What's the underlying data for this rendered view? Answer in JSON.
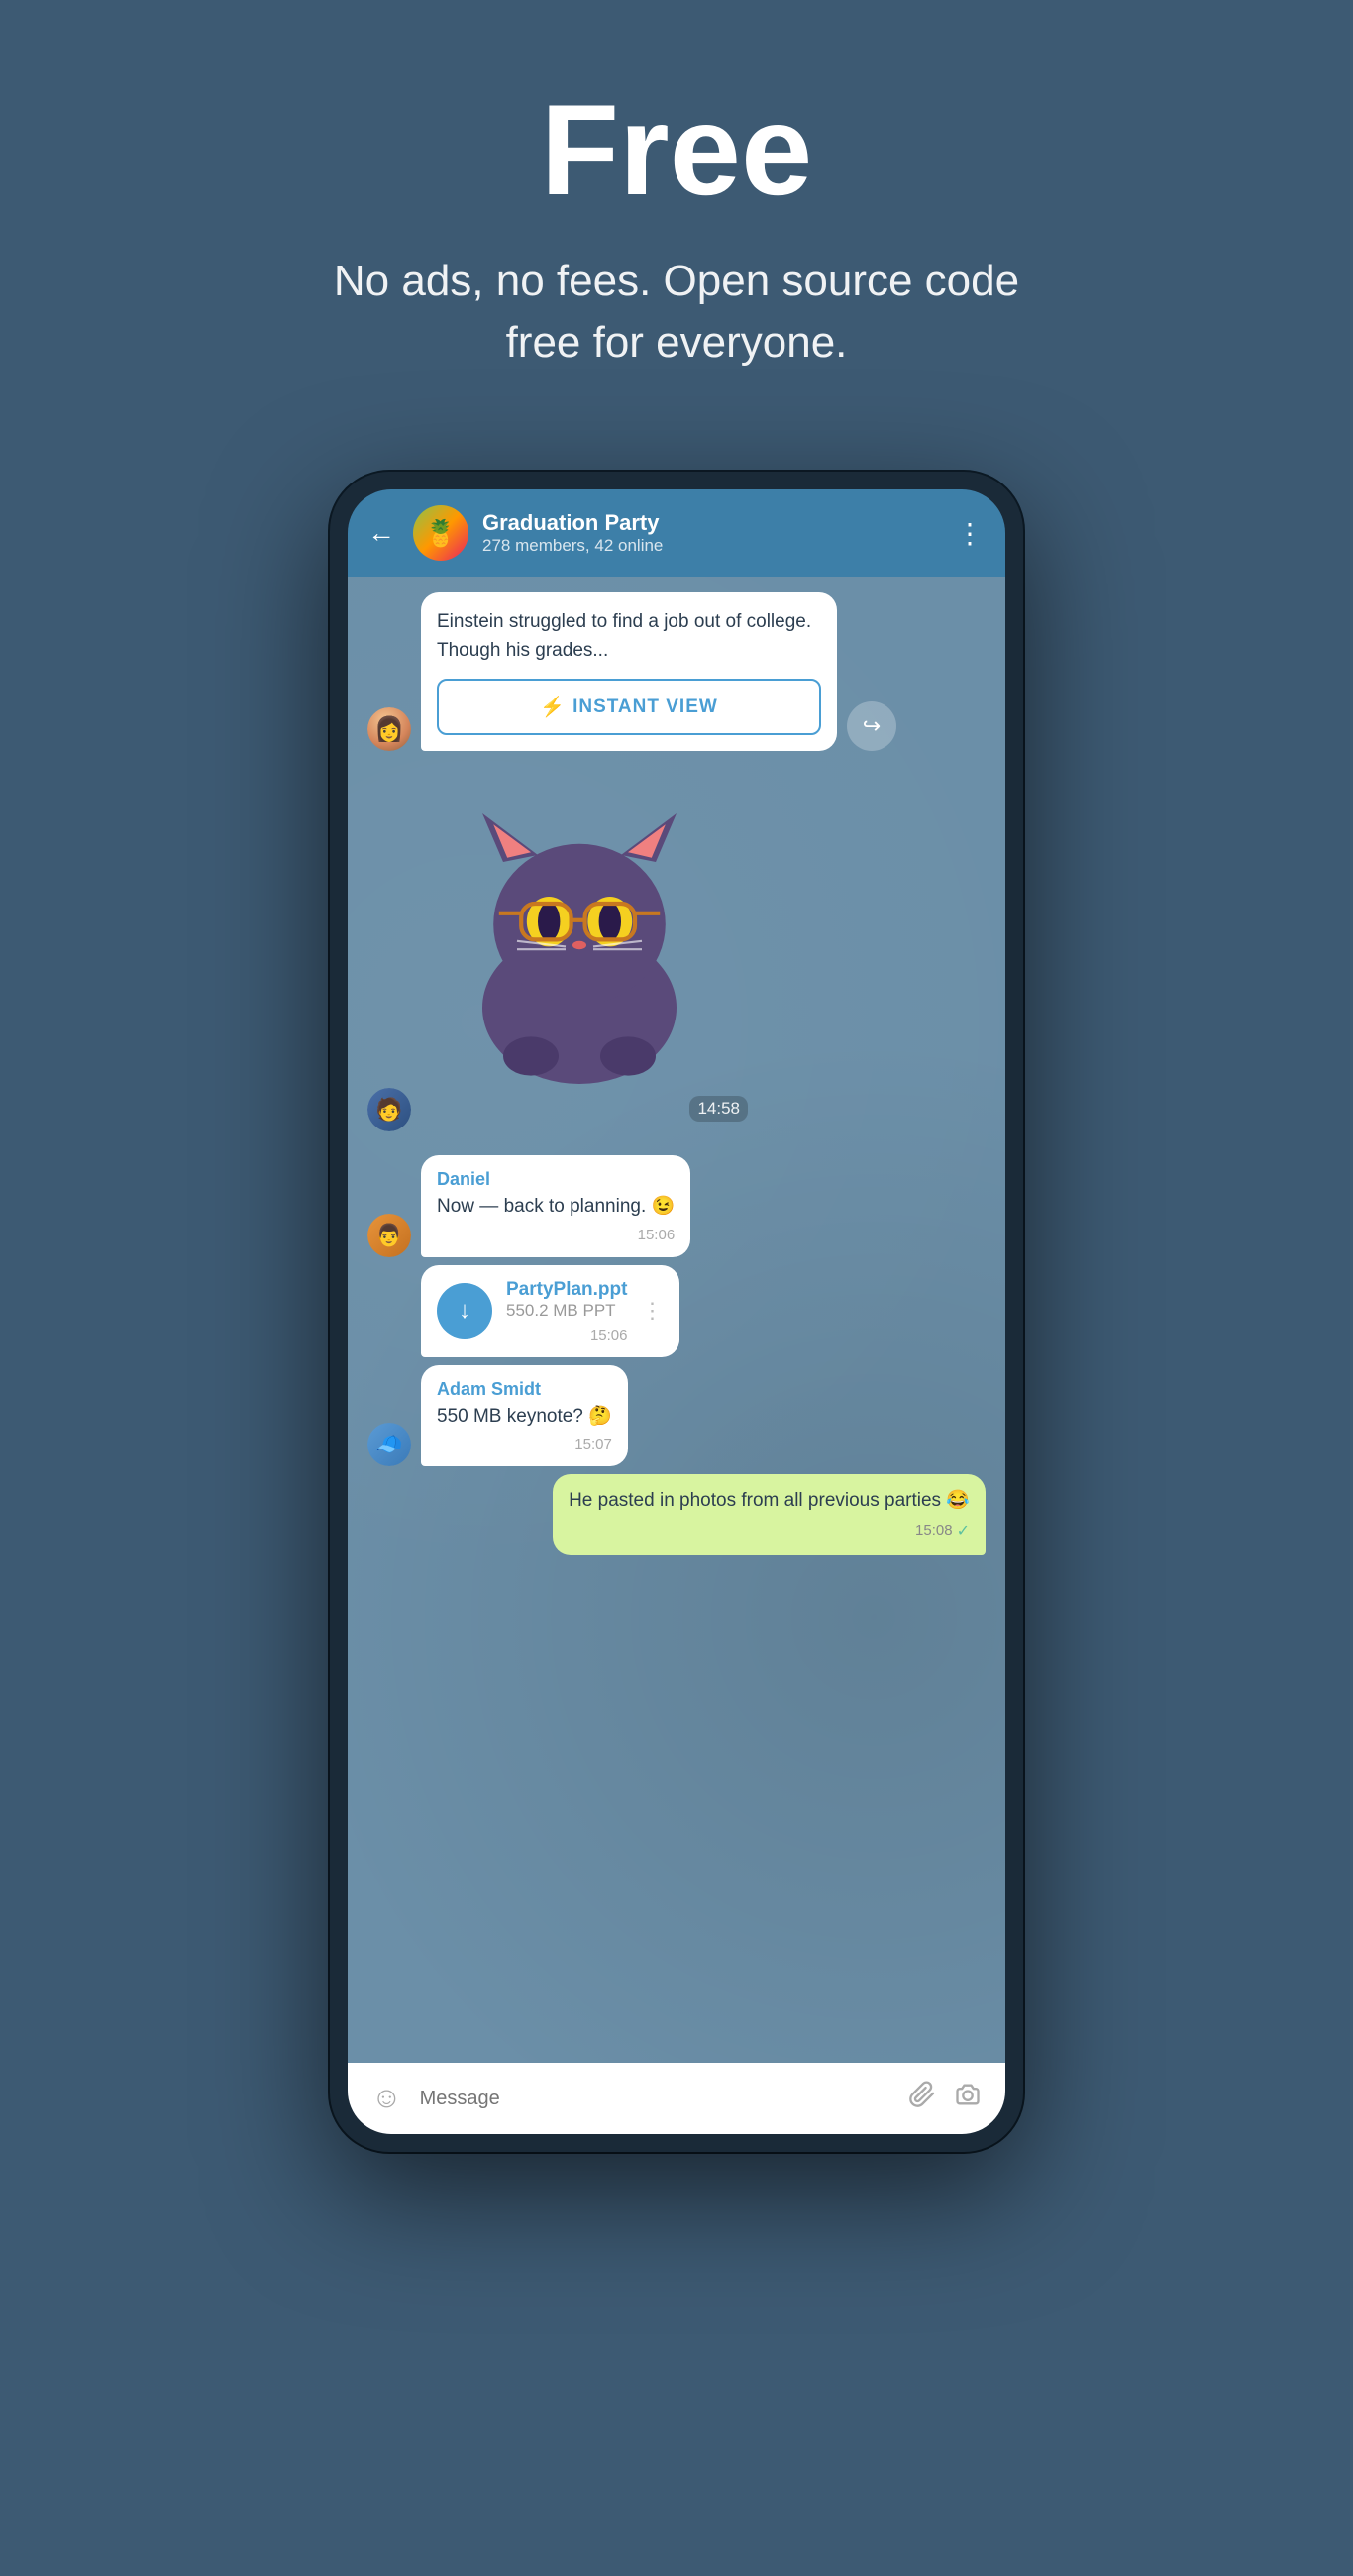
{
  "hero": {
    "title": "Free",
    "subtitle": "No ads, no fees. Open source code free for everyone."
  },
  "chat": {
    "header": {
      "back_label": "←",
      "group_name": "Graduation Party",
      "group_status": "278 members, 42 online",
      "more_icon": "⋮"
    },
    "messages": [
      {
        "type": "article",
        "sender": "girl",
        "text": "Einstein struggled to find a job out of college. Though his grades...",
        "instant_view_label": "INSTANT VIEW"
      },
      {
        "type": "sticker",
        "sender": "boy",
        "time": "14:58"
      },
      {
        "type": "text",
        "sender": "Daniel",
        "sender_color": "#4a9ed4",
        "text": "Now — back to planning. 😉",
        "time": "15:06"
      },
      {
        "type": "file",
        "file_name": "PartyPlan.ppt",
        "file_size": "550.2 MB PPT",
        "time": "15:06",
        "sender": "daniel_avatar"
      },
      {
        "type": "text",
        "sender": "Adam Smidt",
        "sender_color": "#4a9ed4",
        "text": "550 MB keynote? 🤔",
        "time": "15:07",
        "avatar": "adam"
      },
      {
        "type": "text_right",
        "text": "He pasted in photos from all previous parties 😂",
        "time": "15:08",
        "check": "✓"
      }
    ],
    "bottom_bar": {
      "emoji_icon": "☺",
      "placeholder": "Message",
      "attach_icon": "📎",
      "camera_icon": "⊙"
    }
  }
}
